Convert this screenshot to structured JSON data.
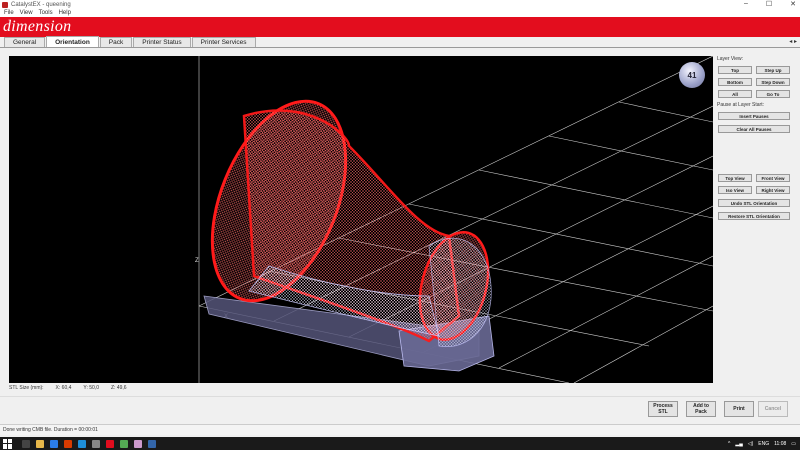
{
  "window": {
    "title": "CatalystEX - queening",
    "controls": [
      "–",
      "☐",
      "✕"
    ]
  },
  "menu": [
    "File",
    "View",
    "Tools",
    "Help"
  ],
  "brand": {
    "logo_text": "dimension",
    "color": "#e30d1e"
  },
  "tabs": [
    {
      "label": "General",
      "active": false
    },
    {
      "label": "Orientation",
      "active": true
    },
    {
      "label": "Pack",
      "active": false
    },
    {
      "label": "Printer Status",
      "active": false
    },
    {
      "label": "Printer Services",
      "active": false
    }
  ],
  "viewport": {
    "nav_cube_label": "41",
    "axis_z": "Z",
    "axis_x": "X"
  },
  "side_panel": {
    "layer_view_label": "Layer View:",
    "top": "Top",
    "step_up": "Step Up",
    "bottom": "Bottom",
    "step_down": "Step Down",
    "all": "All",
    "go_to": "Go To",
    "pause_label": "Pause at Layer Start:",
    "insert_pauses": "Insert Pauses",
    "clear_all_pauses": "Clear All Pauses",
    "top_view": "Top View",
    "front_view": "Front View",
    "iso_view": "Iso View",
    "right_view": "Right View",
    "undo_stl": "Undo STL Orientation",
    "restore_stl": "Restore STL Orientation"
  },
  "stl_size": {
    "label": "STL Size (mm):",
    "x": "X: 60,4",
    "y": "Y: 50,0",
    "z": "Z: 49,6"
  },
  "actions": {
    "process_stl": "Process STL",
    "add_to_pack": "Add to Pack",
    "print": "Print",
    "cancel": "Cancel"
  },
  "status": "Done writing CMB file. Duration = 00:00:01",
  "taskbar": {
    "lang": "ENG",
    "time": "11:08"
  },
  "colors": {
    "model_red": "#ff1a1a",
    "model_support": "#c8c8ff",
    "grid": "#cfcfcf"
  }
}
